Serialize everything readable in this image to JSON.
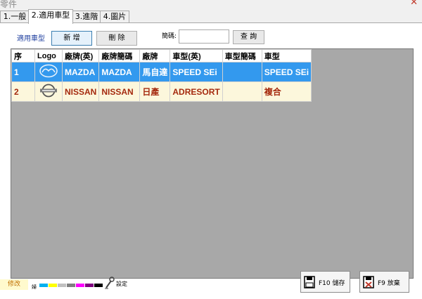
{
  "window": {
    "title": "零件"
  },
  "tabs": [
    {
      "label": "1.一般"
    },
    {
      "label": "2.適用車型"
    },
    {
      "label": "3.進階"
    },
    {
      "label": "4.圖片"
    }
  ],
  "toolbar": {
    "section_label": "適用車型",
    "add_label": "新 增",
    "delete_label": "刪 除",
    "code_label": "簡碼:",
    "code_value": "",
    "query_label": "查 詢"
  },
  "table": {
    "columns": [
      "序",
      "Logo",
      "廠牌(英)",
      "廠牌簡碼",
      "廠牌",
      "車型(英)",
      "車型簡碼",
      "車型"
    ],
    "rows": [
      {
        "seq": "1",
        "logo": "mazda-logo",
        "brand_en": "MAZDA",
        "brand_code": "MAZDA",
        "brand": "馬自達",
        "model_en": "SPEED SEi",
        "model_code": "",
        "model": "SPEED SEi",
        "selected": true
      },
      {
        "seq": "2",
        "logo": "nissan-logo",
        "brand_en": "NISSAN",
        "brand_code": "NISSAN",
        "brand": "日產",
        "model_en": "ADRESORT",
        "model_code": "",
        "model": "複合",
        "selected": false
      }
    ]
  },
  "footer": {
    "modify_label": "修改",
    "palette_label": "婦",
    "palette_colors": [
      "#00b0f0",
      "#ffff00",
      "#c0c0c0",
      "#808080",
      "#ff00ff",
      "#800080",
      "#000000"
    ],
    "setting_label": "設定",
    "save_label": "F10 儲存",
    "discard_label": "F9 放棄"
  },
  "colors": {
    "selected_row": "#3399ee",
    "alt_row": "#fcf7dc",
    "alt_row_text": "#a52a0f",
    "grid_bg": "#a8a8a8"
  }
}
